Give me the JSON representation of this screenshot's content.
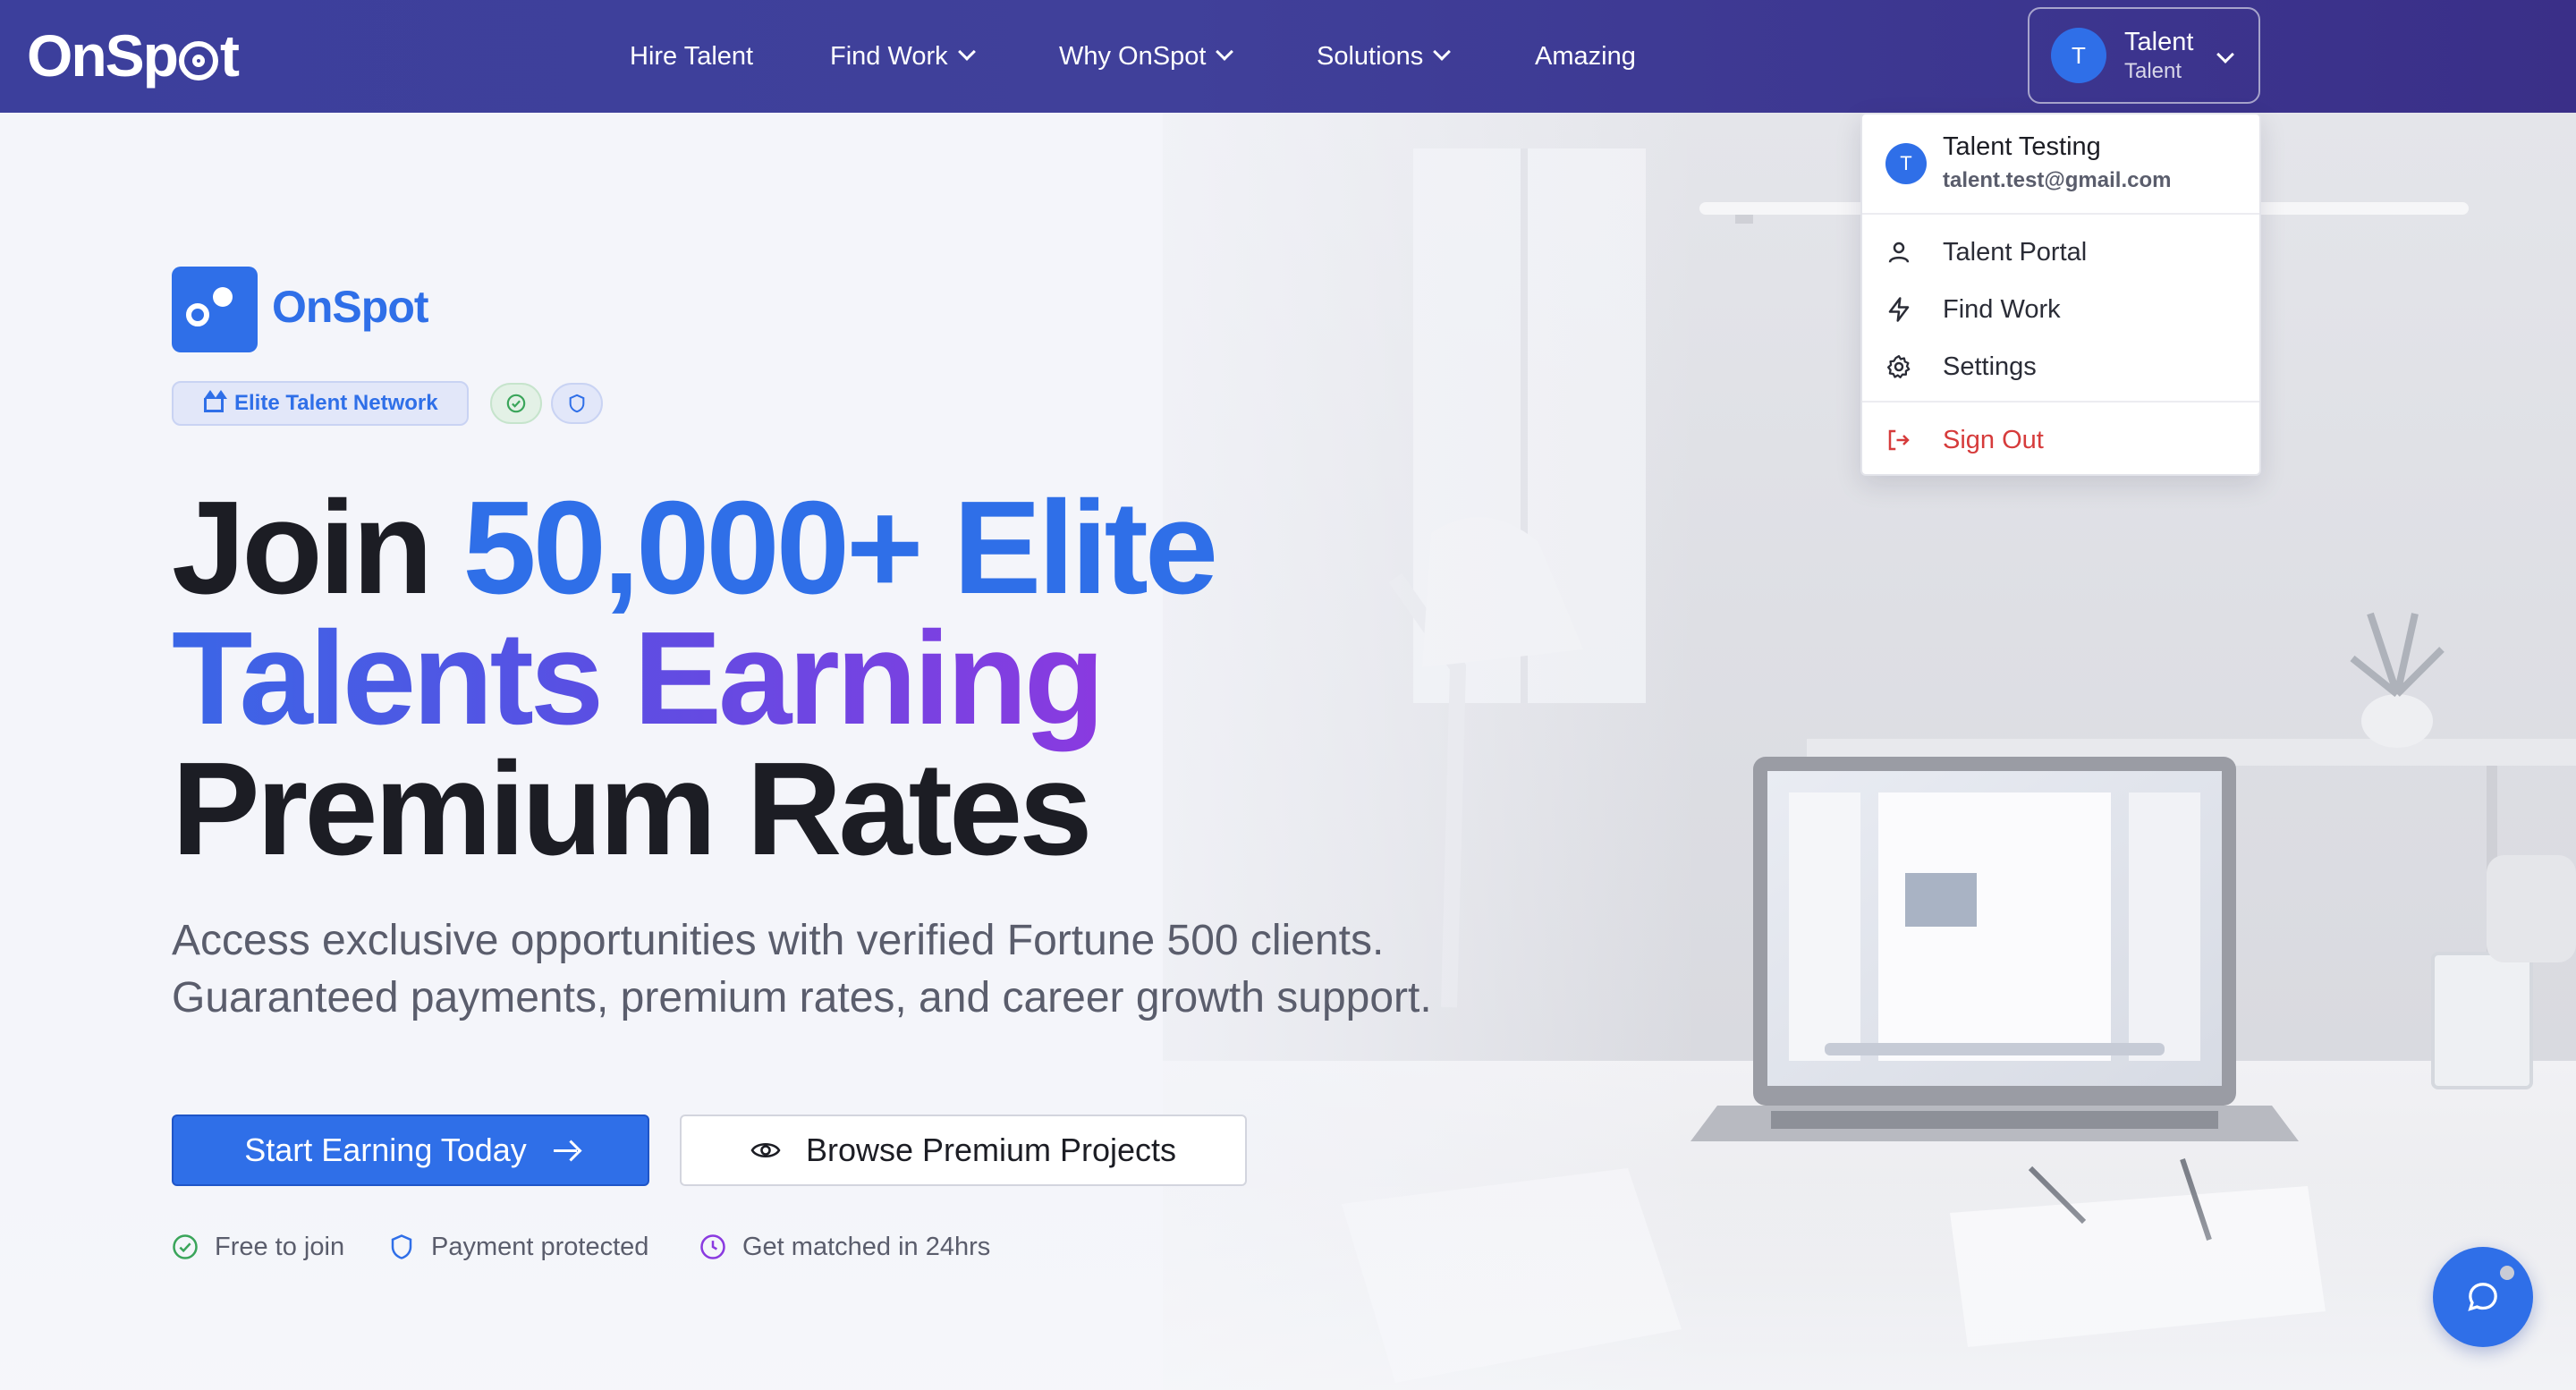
{
  "nav": {
    "brand": "OnSpot",
    "links": [
      "Hire Talent",
      "Find Work",
      "Why OnSpot",
      "Solutions",
      "Amazing"
    ],
    "user": {
      "initial": "T",
      "name": "Talent",
      "role": "Talent"
    }
  },
  "dropdown": {
    "name": "Talent Testing",
    "email": "talent.test@gmail.com",
    "items": [
      "Talent Portal",
      "Find Work",
      "Settings"
    ],
    "signout": "Sign Out"
  },
  "hero": {
    "logo_word": "OnSpot",
    "badge": "Elite Talent Network",
    "headline_join": "Join",
    "headline_accent1": "50,000+ Elite",
    "headline_accent2": "Talents Earning",
    "headline_end": "Premium Rates",
    "sub_line1": "Access exclusive opportunities with verified Fortune 500 clients.",
    "sub_line2": "Guaranteed payments, premium rates, and career growth support.",
    "cta_primary": "Start Earning Today",
    "cta_secondary": "Browse Premium Projects",
    "perks": [
      "Free to join",
      "Payment protected",
      "Get matched in 24hrs"
    ]
  },
  "colors": {
    "primary": "#2f6fe8",
    "nav": "#3c3f9c",
    "signout": "#d63b3b",
    "green": "#3aa55a",
    "purple": "#8a3ae0"
  },
  "icons": [
    "user-icon",
    "bolt-icon",
    "gear-icon",
    "logout-icon",
    "eye-icon",
    "check-circle-icon",
    "shield-icon",
    "clock-icon",
    "chat-icon",
    "crown-icon",
    "chevron-down-icon",
    "arrow-right-icon"
  ]
}
